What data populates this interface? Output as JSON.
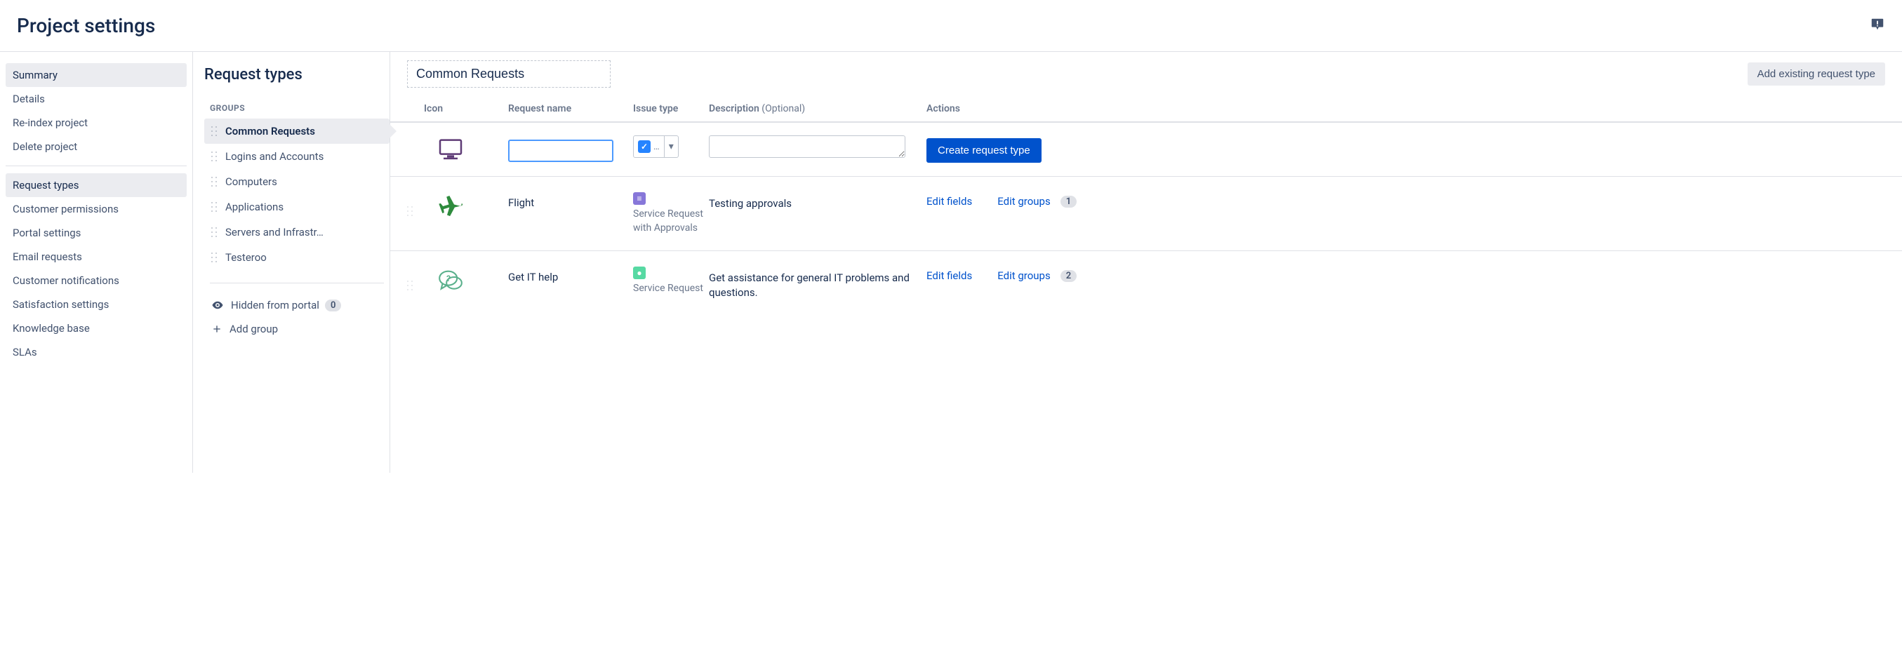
{
  "header": {
    "title": "Project settings"
  },
  "sidebar": {
    "items": [
      {
        "label": "Summary",
        "selected": true
      },
      {
        "label": "Details"
      },
      {
        "label": "Re-index project"
      },
      {
        "label": "Delete project"
      },
      {
        "divider": true
      },
      {
        "label": "Request types",
        "selected": true
      },
      {
        "label": "Customer permissions"
      },
      {
        "label": "Portal settings"
      },
      {
        "label": "Email requests"
      },
      {
        "label": "Customer notifications"
      },
      {
        "label": "Satisfaction settings"
      },
      {
        "label": "Knowledge base"
      },
      {
        "label": "SLAs"
      }
    ]
  },
  "groups_panel": {
    "heading": "Request types",
    "label": "Groups",
    "groups": [
      {
        "label": "Common Requests",
        "active": true
      },
      {
        "label": "Logins and Accounts"
      },
      {
        "label": "Computers"
      },
      {
        "label": "Applications"
      },
      {
        "label": "Servers and Infrastr…"
      },
      {
        "label": "Testeroo"
      }
    ],
    "hidden_label": "Hidden from portal",
    "hidden_count": "0",
    "add_group_label": "Add group"
  },
  "content": {
    "group_name_value": "Common Requests",
    "add_existing_label": "Add existing request type",
    "columns": {
      "icon": "Icon",
      "name": "Request name",
      "issue": "Issue type",
      "desc": "Description",
      "desc_optional": "(Optional)",
      "actions": "Actions"
    },
    "create_row": {
      "issue_type_abbrev": "…",
      "issue_type_color": "#2684FF",
      "create_button": "Create request type"
    },
    "actions_labels": {
      "edit_fields": "Edit fields",
      "edit_groups": "Edit groups"
    },
    "rows": [
      {
        "icon": "airplane",
        "name": "Flight",
        "issue_type": "Service Request with Approvals",
        "issue_color": "#8777D9",
        "description": "Testing approvals",
        "groups_count": "1"
      },
      {
        "icon": "chat-question",
        "name": "Get IT help",
        "issue_type": "Service Request",
        "issue_color": "#57D9A3",
        "description": "Get assistance for general IT problems and questions.",
        "groups_count": "2"
      }
    ]
  }
}
